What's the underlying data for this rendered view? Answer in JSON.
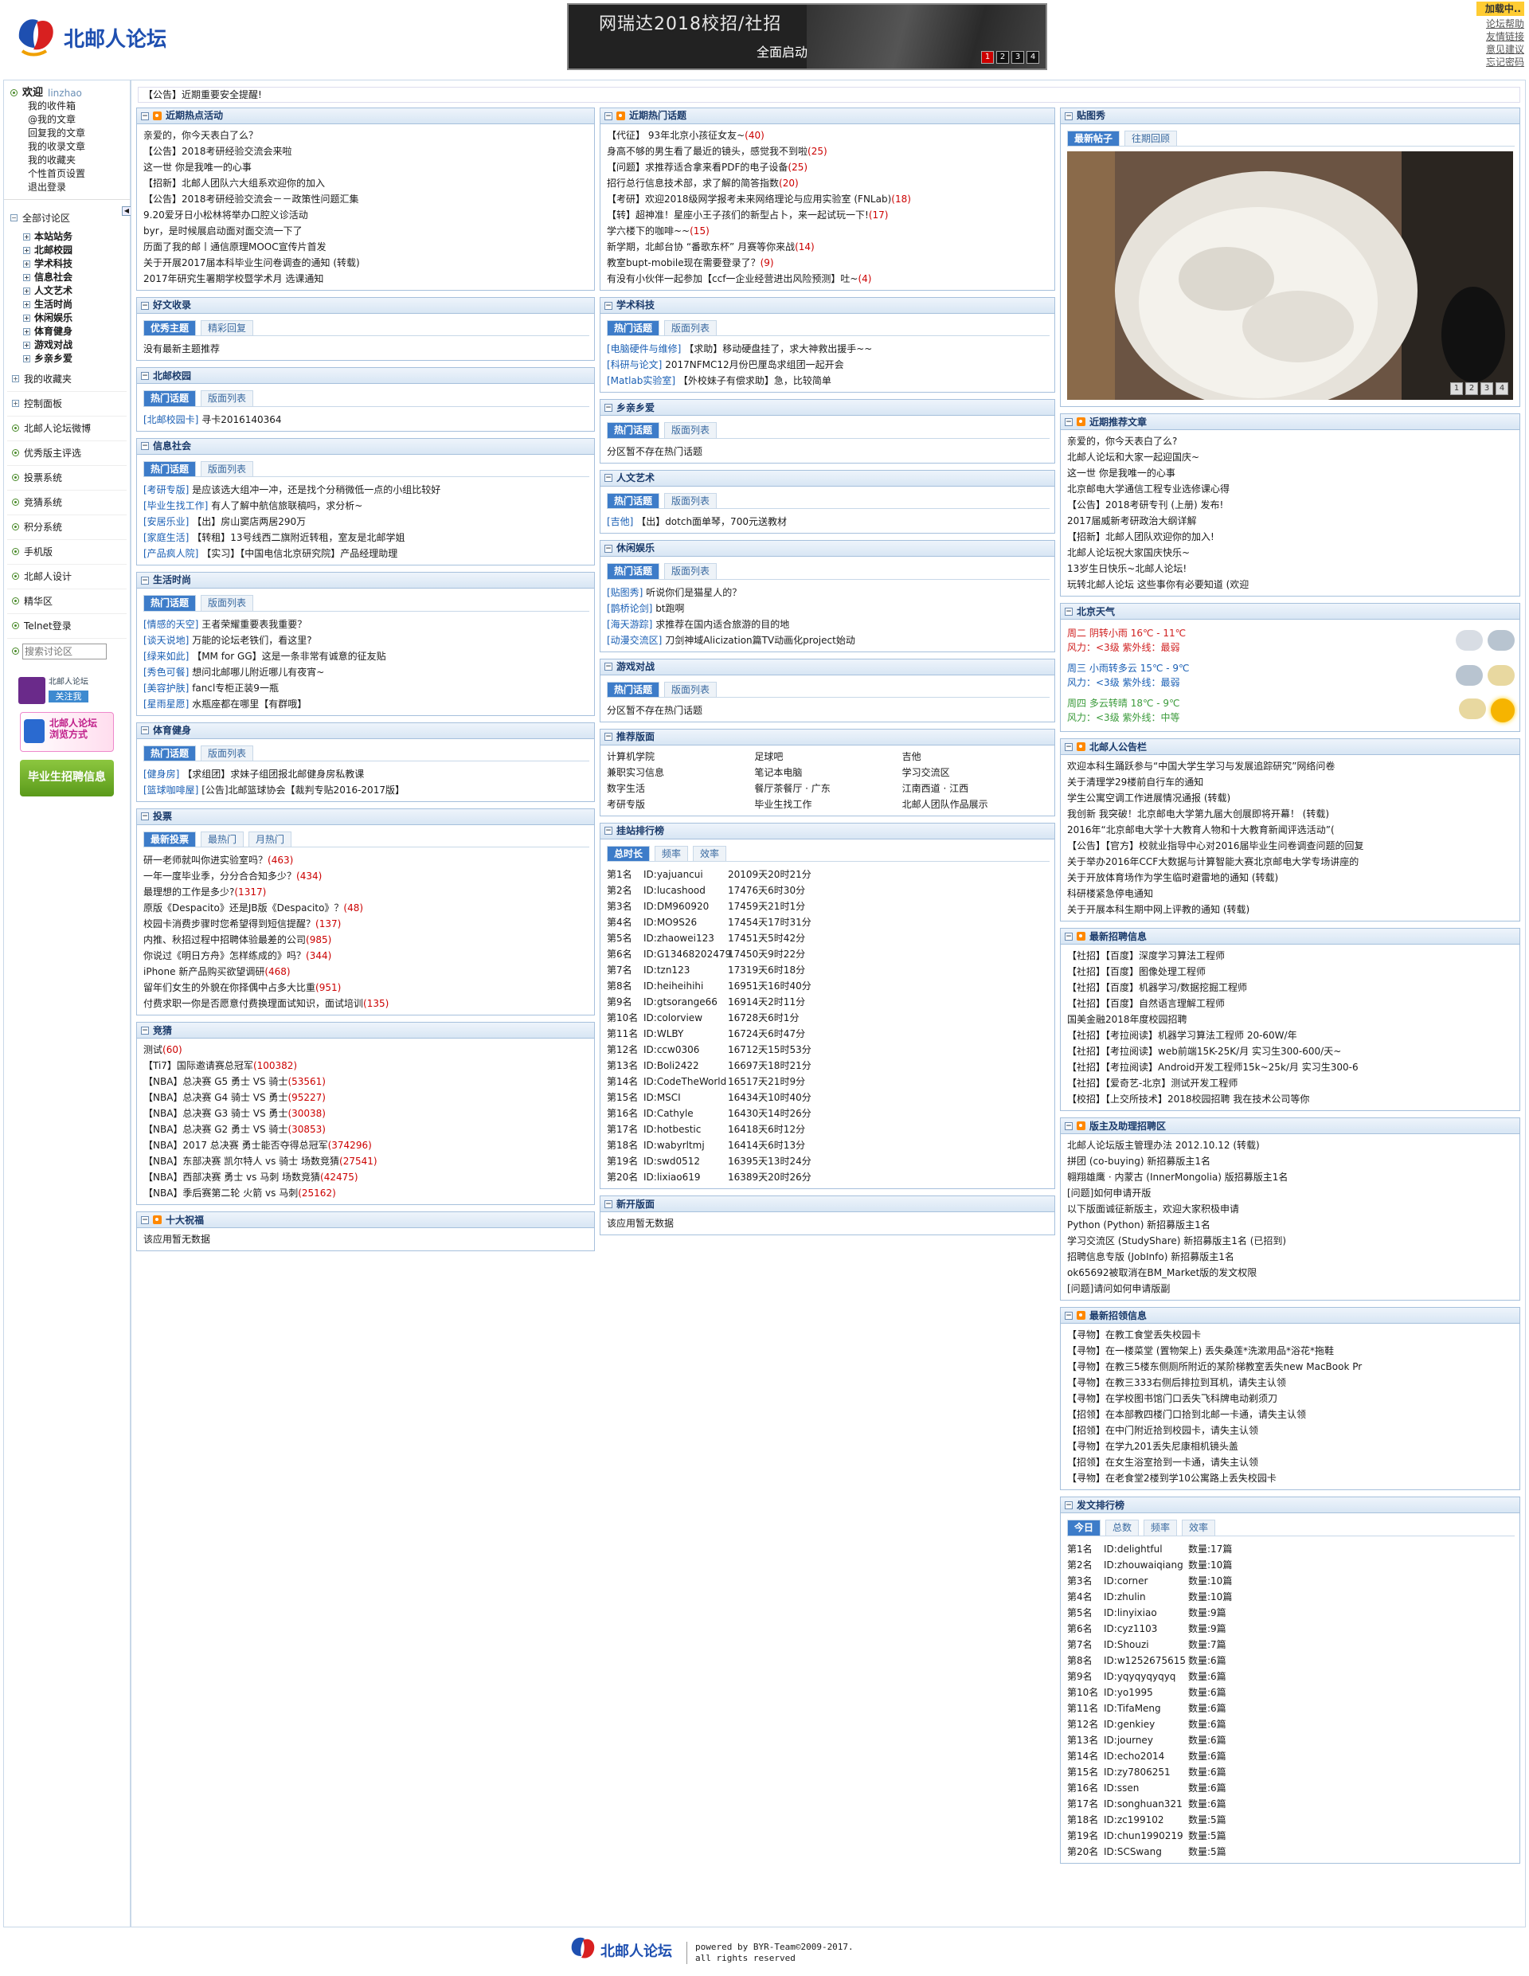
{
  "logo_text": "北邮人论坛",
  "banner": {
    "title": "网瑞达2018校招/社招",
    "subtitle": "全面启动",
    "pages": [
      "1",
      "2",
      "3",
      "4"
    ]
  },
  "top_links": {
    "loading": "加载中..",
    "items": [
      "论坛帮助",
      "友情链接",
      "意见建议",
      "忘记密码"
    ]
  },
  "sidebar": {
    "welcome": "欢迎",
    "user": "linzhao",
    "user_links": [
      "我的收件箱",
      "@我的文章",
      "回复我的文章",
      "我的收录文章",
      "我的收藏夹",
      "个性首页设置",
      "退出登录"
    ],
    "all_boards": "全部讨论区",
    "boards": [
      "本站站务",
      "北邮校园",
      "学术科技",
      "信息社会",
      "人文艺术",
      "生活时尚",
      "休闲娱乐",
      "体育健身",
      "游戏对战",
      "乡亲乡爱"
    ],
    "items": [
      "我的收藏夹",
      "控制面板",
      "北邮人论坛微博",
      "优秀版主评选",
      "投票系统",
      "竞猜系统",
      "积分系统",
      "手机版",
      "北邮人设计",
      "精华区",
      "Telnet登录"
    ],
    "search_placeholder": "搜索讨论区",
    "weibo_label": "北邮人论坛",
    "follow": "关注我",
    "browse_label": "北邮人论坛 浏览方式",
    "recruit_label": "毕业生招聘信息"
  },
  "notice": "【公告】近期重要安全提醒!",
  "col1": {
    "hot": {
      "title": "近期热点活动",
      "items": [
        "亲爱的，你今天表白了么？",
        "【公告】2018考研经验交流会来啦",
        "这一世 你是我唯一的心事",
        "【招新】北邮人团队六大组系欢迎你的加入",
        "【公告】2018考研经验交流会－－政策性问题汇集",
        "9.20爱牙日小松林将举办口腔义诊活动",
        "byr，是时候展启动面对面交流一下了",
        "历面了我的邮丨通信原理MOOC宣传片首发",
        "关于开展2017届本科毕业生问卷调查的通知 (转载)",
        "2017年研究生署期学校暨学术月 选课通知"
      ]
    },
    "good": {
      "title": "好文收录",
      "tabs": [
        "优秀主题",
        "精彩回复"
      ],
      "empty": "没有最新主题推荐"
    },
    "campus": {
      "title": "北邮校园",
      "tabs": [
        "热门话题",
        "版面列表"
      ],
      "items": [
        {
          "b": "[北邮校园卡]",
          "t": " 寻卡2016140364"
        }
      ]
    },
    "info": {
      "title": "信息社会",
      "tabs": [
        "热门话题",
        "版面列表"
      ],
      "items": [
        {
          "b": "[考研专版]",
          "t": " 是应该选大组冲一冲，还是找个分稍微低一点的小组比较好"
        },
        {
          "b": "[毕业生找工作]",
          "t": " 有人了解中航信旅联稿吗，求分析~"
        },
        {
          "b": "[安居乐业]",
          "t": " 【出】房山窦店两居290万"
        },
        {
          "b": "[家庭生活]",
          "t": " 【转租】13号线西二旗附近转租，室友是北邮学姐"
        },
        {
          "b": "[产品疯人院]",
          "t": " 【实习】【中国电信北京研究院】产品经理助理"
        }
      ]
    },
    "life": {
      "title": "生活时尚",
      "tabs": [
        "热门话题",
        "版面列表"
      ],
      "items": [
        {
          "b": "[情感的天空]",
          "t": " 王者荣耀重要表我重要？"
        },
        {
          "b": "[谈天说地]",
          "t": " 万能的论坛老铁们，看这里?"
        },
        {
          "b": "[绿来如此]",
          "t": " 【MM for GG】这是一条非常有诚意的征友贴"
        },
        {
          "b": "[秀色可餐]",
          "t": " 想问北邮哪儿附近哪儿有夜宵~"
        },
        {
          "b": "[美容护肤]",
          "t": " fancl专柜正装9一瓶"
        },
        {
          "b": "[星雨星愿]",
          "t": " 水瓶座都在哪里【有群哦】"
        }
      ]
    },
    "sport": {
      "title": "体育健身",
      "tabs": [
        "热门话题",
        "版面列表"
      ],
      "items": [
        {
          "b": "[健身房]",
          "t": " 【求组团】求妹子组团报北邮健身房私教课"
        },
        {
          "b": "[篮球咖啡屋]",
          "t": " [公告]北邮篮球协会【裁判专贴2016-2017版】"
        }
      ]
    },
    "vote": {
      "title": "投票",
      "tabs": [
        "最新投票",
        "最热门",
        "月热门"
      ],
      "items": [
        {
          "t": "研一老师就叫你进实验室吗？",
          "n": "(463)"
        },
        {
          "t": "一年一度毕业季，分分合合知多少？",
          "n": "(434)"
        },
        {
          "t": "最理想的工作是多少?",
          "n": "(1317)"
        },
        {
          "t": "原版《Despacito》还是JB版《Despacito》？",
          "n": "(48)"
        },
        {
          "t": "校园卡消费步骤时您希望得到短信提醒？",
          "n": "(137)"
        },
        {
          "t": "内推、秋招过程中招聘体验最差的公司",
          "n": "(985)"
        },
        {
          "t": "你说过《明日方舟》怎样练成的》吗？",
          "n": "(344)"
        },
        {
          "t": "iPhone 新产品购买欲望调研",
          "n": "(468)"
        },
        {
          "t": "留年们女生的外貌在你择偶中占多大比重",
          "n": "(951)"
        },
        {
          "t": "付费求职一你是否愿意付费换理面试知识，面试培训",
          "n": "(135)"
        }
      ]
    },
    "guess": {
      "title": "竞猜",
      "items": [
        {
          "t": "测试",
          "n": "(60)"
        },
        {
          "t": "【Ti7】国际邀请赛总冠军",
          "n": "(100382)"
        },
        {
          "t": "【NBA】总决赛 G5 勇士 VS 骑士",
          "n": "(53561)"
        },
        {
          "t": "【NBA】总决赛 G4 骑士 VS 勇士",
          "n": "(95227)"
        },
        {
          "t": "【NBA】总决赛 G3 骑士 VS 勇士",
          "n": "(30038)"
        },
        {
          "t": "【NBA】总决赛 G2 勇士 VS 骑士",
          "n": "(30853)"
        },
        {
          "t": "【NBA】2017 总决赛 勇士能否夺得总冠军",
          "n": "(374296)"
        },
        {
          "t": "【NBA】东部决赛 凯尔特人 vs 骑士 场数竞猜",
          "n": "(27541)"
        },
        {
          "t": "【NBA】西部决赛 勇士 vs 马刺 场数竞猜",
          "n": "(42475)"
        },
        {
          "t": "【NBA】季后赛第二轮 火箭 vs 马刺",
          "n": "(25162)"
        }
      ]
    },
    "ten": {
      "title": "十大祝福",
      "empty": "该应用暂无数据"
    }
  },
  "col2": {
    "hot_topics": {
      "title": "近期热门话题",
      "items": [
        {
          "t": "【代征】 93年北京小孩征女友~",
          "n": "(40)"
        },
        {
          "t": "身高不够的男生看了最近的镜头，感觉我不到啦",
          "n": "(25)"
        },
        {
          "t": "【问题】求推荐适合拿来看PDF的电子设备",
          "n": "(25)"
        },
        {
          "t": "招行总行信息技术部，求了解的简答指数",
          "n": "(20)"
        },
        {
          "t": "【考研】欢迎2018级网学报考未来网络理论与应用实验室 (FNLab)",
          "n": "(18)"
        },
        {
          "t": "【转】超神准！星座小王子孩们的新型占卜，来一起试玩一下!",
          "n": "(17)"
        },
        {
          "t": "学六楼下的咖啡~~",
          "n": "(15)"
        },
        {
          "t": "新学期，北邮台协 “番歌东杯” 月赛等你来战",
          "n": "(14)"
        },
        {
          "t": "教室bupt-mobile现在需要登录了？",
          "n": "(9)"
        },
        {
          "t": "有没有小伙伴一起参加【ccf一企业经营进出风险预测】吐~",
          "n": "(4)"
        }
      ]
    },
    "academic": {
      "title": "学术科技",
      "tabs": [
        "热门话题",
        "版面列表"
      ],
      "items": [
        {
          "b": "[电脑硬件与维修]",
          "t": " 【求助】移动硬盘挂了，求大神救出援手~~"
        },
        {
          "b": "[科研与论文]",
          "t": " 2017NFMC12月份巴厘岛求组团一起开会"
        },
        {
          "b": "[Matlab实验室]",
          "t": " 【外校妹子有偿求助】急，比较简单"
        }
      ]
    },
    "hometown": {
      "title": "乡亲乡爱",
      "tabs": [
        "热门话题",
        "版面列表"
      ],
      "empty": "分区暂不存在热门话题"
    },
    "arts": {
      "title": "人文艺术",
      "tabs": [
        "热门话题",
        "版面列表"
      ],
      "items": [
        {
          "b": "[吉他]",
          "t": " 【出】dotch面单琴，700元送教材"
        }
      ]
    },
    "leisure": {
      "title": "休闲娱乐",
      "tabs": [
        "热门话题",
        "版面列表"
      ],
      "items": [
        {
          "b": "[贴图秀]",
          "t": " 听说你们是猫星人的？"
        },
        {
          "b": "[鹊桥论剑]",
          "t": " bt跑啊"
        },
        {
          "b": "[海天游踪]",
          "t": " 求推荐在国内适合旅游的目的地"
        },
        {
          "b": "[动漫交流区]",
          "t": " 刀剑神域Alicization篇TV动画化project始动"
        }
      ]
    },
    "games": {
      "title": "游戏对战",
      "tabs": [
        "热门话题",
        "版面列表"
      ],
      "empty": "分区暂不存在热门话题"
    },
    "recommend": {
      "title": "推荐版面",
      "items": [
        "计算机学院",
        "足球吧",
        "吉他",
        "兼职实习信息",
        "笔记本电脑",
        "学习交流区",
        "数字生活",
        "餐厅茶餐厅 · 广东",
        "江南西道 · 江西",
        "考研专版",
        "毕业生找工作",
        "北邮人团队作品展示"
      ]
    },
    "online": {
      "title": "挂站排行榜",
      "tabs": [
        "总时长",
        "频率",
        "效率"
      ],
      "rows": [
        [
          "第1名",
          "ID:yajuancui",
          "20109天20时21分"
        ],
        [
          "第2名",
          "ID:lucashood",
          "17476天6时30分"
        ],
        [
          "第3名",
          "ID:DM960920",
          "17459天21时1分"
        ],
        [
          "第4名",
          "ID:MO9S26",
          "17454天17时31分"
        ],
        [
          "第5名",
          "ID:zhaowei123",
          "17451天5时42分"
        ],
        [
          "第6名",
          "ID:G13468202479",
          "17450天9时22分"
        ],
        [
          "第7名",
          "ID:tzn123",
          "17319天6时18分"
        ],
        [
          "第8名",
          "ID:heiheihihi",
          "16951天16时40分"
        ],
        [
          "第9名",
          "ID:gtsorange66",
          "16914天2时11分"
        ],
        [
          "第10名",
          "ID:colorview",
          "16728天6时1分"
        ],
        [
          "第11名",
          "ID:WLBY",
          "16724天6时47分"
        ],
        [
          "第12名",
          "ID:ccw0306",
          "16712天15时53分"
        ],
        [
          "第13名",
          "ID:Boli2422",
          "16697天18时21分"
        ],
        [
          "第14名",
          "ID:CodeTheWorld",
          "16517天21时9分"
        ],
        [
          "第15名",
          "ID:MSCI",
          "16434天10时40分"
        ],
        [
          "第16名",
          "ID:Cathyle",
          "16430天14时26分"
        ],
        [
          "第17名",
          "ID:hotbestic",
          "16418天6时12分"
        ],
        [
          "第18名",
          "ID:wabyrltmj",
          "16414天6时13分"
        ],
        [
          "第19名",
          "ID:swd0512",
          "16395天13时24分"
        ],
        [
          "第20名",
          "ID:lixiao619",
          "16389天20时26分"
        ]
      ]
    },
    "newboard": {
      "title": "新开版面",
      "empty": "该应用暂无数据"
    }
  },
  "col3": {
    "photo": {
      "title": "贴图秀",
      "tabs": [
        "最新帖子",
        "往期回顾"
      ],
      "pages": [
        "1",
        "2",
        "3",
        "4"
      ]
    },
    "recent": {
      "title": "近期推荐文章",
      "items": [
        "亲爱的，你今天表白了么?",
        "北邮人论坛和大家一起迎国庆~",
        "这一世 你是我唯一的心事",
        "北京邮电大学通信工程专业选修课心得",
        "【公告】2018考研专刊 (上册) 发布!",
        "2017届威新考研政治大纲详解",
        "【招新】北邮人团队欢迎你的加入!",
        "北邮人论坛祝大家国庆快乐~",
        "13岁生日快乐~北邮人论坛!",
        "玩转北邮人论坛 这些事你有必要知道 (欢迎"
      ]
    },
    "weather": {
      "title": "北京天气",
      "days": [
        {
          "d": "周二",
          "w": "阴转小雨",
          "t": "16℃ - 11℃",
          "wind": "风力：<3级 紫外线：最弱"
        },
        {
          "d": "周三",
          "w": "小雨转多云",
          "t": "15℃ - 9℃",
          "wind": "风力：<3级 紫外线：最弱"
        },
        {
          "d": "周四",
          "w": "多云转晴",
          "t": "18℃ - 9℃",
          "wind": "风力：<3级 紫外线：中等"
        }
      ]
    },
    "announce": {
      "title": "北邮人公告栏",
      "items": [
        "欢迎本科生踊跃参与“中国大学生学习与发展追踪研究”网络问卷",
        "关于清理学29楼前自行车的通知",
        "学生公寓空调工作进展情况通报 (转载)",
        "我创新 我突破！北京邮电大学第九届大创展即将开幕！ (转载)",
        "2016年“北京邮电大学十大教育人物和十大教育新闻评选活动”(",
        "【公告】【官方】校就业指导中心对2016届毕业生问卷调查问题的回复",
        "关于举办2016年CCF大数据与计算智能大赛北京邮电大学专场讲座的",
        "关于开放体育场作为学生临时避雷地的通知 (转载)",
        "科研楼紧急停电通知",
        "关于开展本科生期中网上评教的通知 (转载)"
      ]
    },
    "jobs": {
      "title": "最新招聘信息",
      "items": [
        "【社招】【百度】深度学习算法工程师",
        "【社招】【百度】图像处理工程师",
        "【社招】【百度】机器学习/数据挖掘工程师",
        "【社招】【百度】自然语言理解工程师",
        "国美金融2018年度校园招聘",
        "【社招】【考拉阅读】机器学习算法工程师 20-60W/年",
        "【社招】【考拉阅读】web前端15K-25K/月 实习生300-600/天~",
        "【社招】【考拉阅读】Android开发工程师15k~25k/月 实习生300-6",
        "【社招】【爱奇艺-北京】测试开发工程师",
        "【校招】【上交所技术】2018校园招聘 我在技术公司等你"
      ]
    },
    "moderator": {
      "title": "版主及助理招聘区",
      "items": [
        "北邮人论坛版主管理办法 2012.10.12 (转载)",
        "拼团 (co-buying) 新招募版主1名",
        "翱翔雄鹰 · 内蒙古 (InnerMongolia) 版招募版主1名",
        "[问题]如何申请开版",
        "以下版面诚征新版主，欢迎大家积极申请",
        "Python (Python) 新招募版主1名",
        "学习交流区 (StudyShare) 新招募版主1名 (已招到)",
        "招聘信息专版 (JobInfo) 新招募版主1名",
        "ok65692被取消在BM_Market版的发文权限",
        "[问题]请问如何申请版副"
      ]
    },
    "lost": {
      "title": "最新招领信息",
      "items": [
        "【寻物】在教工食堂丢失校园卡",
        "【寻物】在一楼菜堂 (置物架上) 丢失桑莲*洗漱用品*浴花*拖鞋",
        "【寻物】在教三5楼东侧厕所附近的某阶梯教室丢失new MacBook Pr",
        "【寻物】在教三333右侧后排拉到耳机，请失主认领",
        "【寻物】在学校图书馆门口丢失飞科牌电动剃须刀",
        "【招领】在本部教四楼门口拾到北邮一卡通，请失主认领",
        "【招领】在中门附近拾到校园卡，请失主认领",
        "【寻物】在学九201丢失尼康相机镜头盖",
        "【招领】在女生浴室拾到一卡通，请失主认领",
        "【寻物】在老食堂2楼到学10公寓路上丢失校园卡"
      ]
    },
    "posts": {
      "title": "发文排行榜",
      "tabs": [
        "今日",
        "总数",
        "频率",
        "效率"
      ],
      "rows": [
        [
          "第1名",
          "ID:delightful",
          "数量:17篇"
        ],
        [
          "第2名",
          "ID:zhouwaiqiang",
          "数量:10篇"
        ],
        [
          "第3名",
          "ID:corner",
          "数量:10篇"
        ],
        [
          "第4名",
          "ID:zhulin",
          "数量:10篇"
        ],
        [
          "第5名",
          "ID:linyixiao",
          "数量:9篇"
        ],
        [
          "第6名",
          "ID:cyz1103",
          "数量:9篇"
        ],
        [
          "第7名",
          "ID:Shouzi",
          "数量:7篇"
        ],
        [
          "第8名",
          "ID:w1252675615",
          "数量:6篇"
        ],
        [
          "第9名",
          "ID:yqyqyqyqyq",
          "数量:6篇"
        ],
        [
          "第10名",
          "ID:yo1995",
          "数量:6篇"
        ],
        [
          "第11名",
          "ID:TifaMeng",
          "数量:6篇"
        ],
        [
          "第12名",
          "ID:genkiey",
          "数量:6篇"
        ],
        [
          "第13名",
          "ID:journey",
          "数量:6篇"
        ],
        [
          "第14名",
          "ID:echo2014",
          "数量:6篇"
        ],
        [
          "第15名",
          "ID:zy7806251",
          "数量:6篇"
        ],
        [
          "第16名",
          "ID:ssen",
          "数量:6篇"
        ],
        [
          "第17名",
          "ID:songhuan321",
          "数量:6篇"
        ],
        [
          "第18名",
          "ID:zc199102",
          "数量:5篇"
        ],
        [
          "第19名",
          "ID:chun1990219",
          "数量:5篇"
        ],
        [
          "第20名",
          "ID:SCSwang",
          "数量:5篇"
        ]
      ]
    }
  },
  "footer": {
    "line1": "powered by BYR-Team©2009-2017.",
    "line2": "all rights reserved"
  }
}
